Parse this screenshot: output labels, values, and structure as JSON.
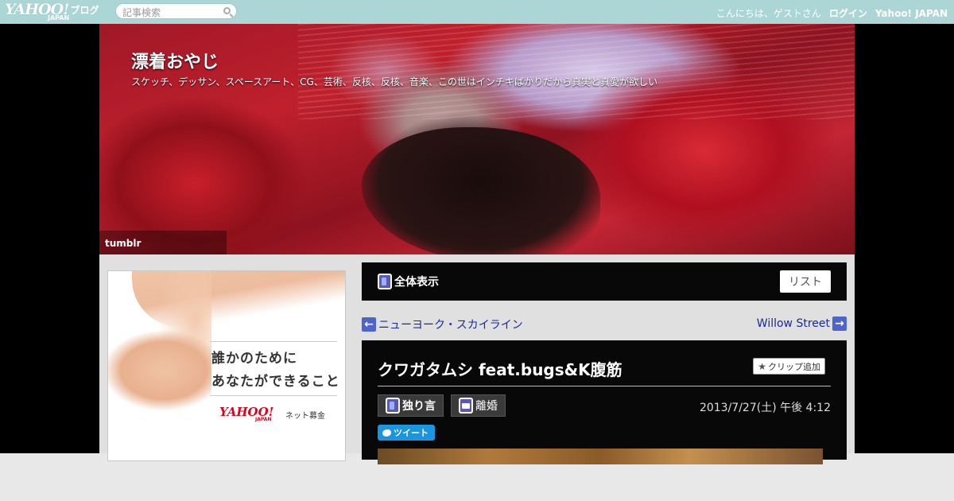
{
  "topbar": {
    "logo_text": "YAHOO!",
    "logo_sub": "JAPAN",
    "logo_service": "ブログ",
    "search_placeholder": "記事検索",
    "greeting": "こんにちは、ゲストさん",
    "login": "ログイン",
    "portal": "Yahoo! JAPAN"
  },
  "header": {
    "blog_title": "漂着おやじ",
    "blog_description": "スケッチ、デッサン、スペースアート、CG、芸術、反核、反核、音楽、この世はインチキばかりだから真実と真愛が欲しい",
    "tumblr_label": "tumblr"
  },
  "ad": {
    "copy_line1": "誰かのために",
    "copy_line2": "あなたができること",
    "brand": "YAHOO!",
    "brand_sub": "JAPAN",
    "service": "ネット募金"
  },
  "panel": {
    "view_label": "全体表示",
    "list_button": "リスト"
  },
  "nav": {
    "prev_label": "ニューヨーク・スカイライン",
    "next_label": "Willow Street"
  },
  "article": {
    "title": "クワガタムシ feat.bugs&K腹筋",
    "clip_label": "クリップ追加",
    "category1": "独り言",
    "category2": "離婚",
    "date": "2013/7/27(土) 午後 4:12",
    "tweet_label": "ツイート"
  },
  "icons": {
    "search": "search-icon",
    "book": "book-icon",
    "folder": "folder-icon",
    "star": "star-icon",
    "arrow_left": "arrow-left-icon",
    "arrow_right": "arrow-right-icon",
    "bird": "twitter-bird-icon"
  },
  "colors": {
    "topbar": "#acd6d6",
    "link": "#1a2a9a",
    "arrow": "#4d64c9",
    "tweet": "#1b95e0",
    "panel": "#080808"
  }
}
